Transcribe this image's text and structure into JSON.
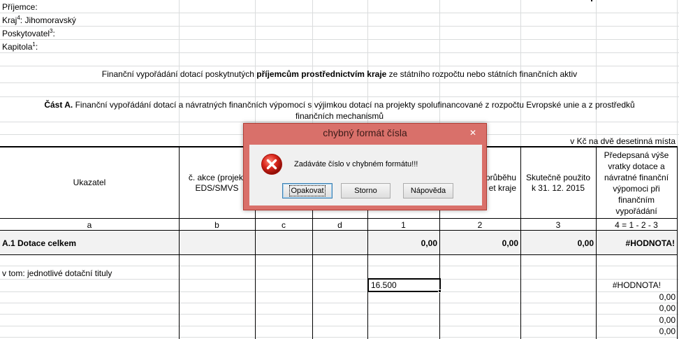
{
  "header": {
    "prijemce_label": "Příjemce:",
    "kraj_label": "Kraj",
    "kraj_sup": "4",
    "kraj_value": ": Jihomoravský",
    "poskytovatel_label": "Poskytovatel",
    "poskytovatel_sup": "3",
    "poskytovatel_suffix": ":",
    "kapitola_label": "Kapitola",
    "kapitola_sup": "1",
    "kapitola_suffix": ":"
  },
  "title": {
    "pre": "Finanční vypořádání dotací poskytnutých ",
    "bold": "příjemcům prostřednictvím kraje",
    "post": " ze státního rozpočtu nebo státních finančních aktiv"
  },
  "part_a": {
    "bold": "Část A.",
    "line1": " Finanční vypořádání dotací a návratných finančních výpomocí s výjimkou dotací na projekty spolufinancované z rozpočtu Evropské unie a z prostředků",
    "line2": "finančních mechanismů"
  },
  "units_note": "v Kč na dvě desetinná místa",
  "table": {
    "col_ukazatel": "Ukazatel",
    "col_akce_1": "č. akce (projekt",
    "col_akce_2": "EDS/SMVS",
    "col_prubehu_1": "průběhu",
    "col_prubehu_2": "et kraje",
    "col_skutecne_1": "Skutečně použito",
    "col_skutecne_2": "k 31. 12. 2015",
    "col_vratka": [
      "Předepsaná výše",
      "vratky dotace a",
      "návratné finanční",
      "výpomoci při",
      "finančním",
      "vypořádání"
    ],
    "letters": [
      "a",
      "b",
      "c",
      "d",
      "1",
      "2",
      "3",
      "4 = 1 - 2 - 3"
    ],
    "total_row": {
      "label": "A.1 Dotace celkem",
      "c1": "0,00",
      "c2": "0,00",
      "c3": "0,00",
      "c4": "#HODNOTA!"
    },
    "sub_label": "v tom: jednotlivé dotační tituly",
    "active_cell_value": "16.500",
    "row_vals": [
      "#HODNOTA!",
      "0,00",
      "0,00",
      "0,00",
      "0,00"
    ]
  },
  "dialog": {
    "title": "chybný formát čísla",
    "close_glyph": "✕",
    "message": "Zadáváte číslo v chybném formátu!!!",
    "buttons": {
      "retry": "Opakovat",
      "cancel": "Storno",
      "help": "Nápověda"
    },
    "icon": "error-icon",
    "accent_color": "#d9706a"
  }
}
